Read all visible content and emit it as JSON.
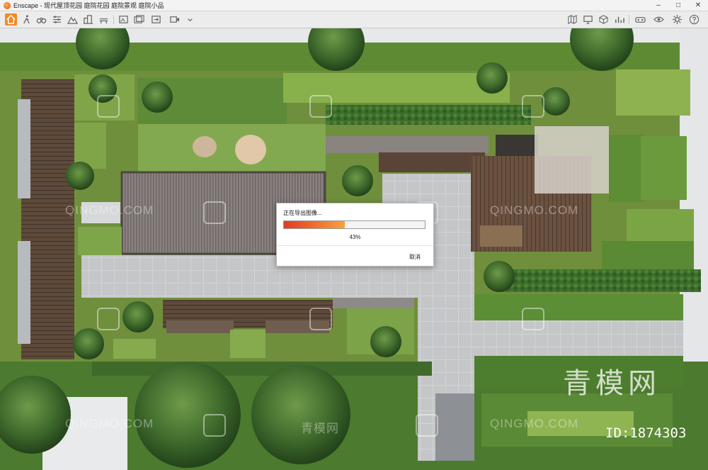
{
  "window": {
    "title": "Enscape - 现代屋顶花园 庭院花园 庭院景观 庭院小品",
    "controls": {
      "minimize": "–",
      "maximize": "□",
      "close": "✕"
    }
  },
  "toolbar": {
    "left_icons": [
      "home-icon",
      "walk-mode-icon",
      "binoculars-icon",
      "settings-sliders-icon",
      "mountain-icon",
      "person-icon",
      "buildings-icon",
      "bench-icon",
      "tree-icon",
      "screenshot-icon",
      "export-icon",
      "image-gallery-icon",
      "video-icon",
      "batch-render-icon",
      "panorama-icon"
    ],
    "right_icons": [
      "map-icon",
      "monitor-icon",
      "cube-icon",
      "chart-icon",
      "asset-library-icon",
      "vr-headset-icon",
      "visual-settings-icon",
      "eye-icon",
      "gear-icon",
      "help-icon"
    ],
    "active": "home-icon"
  },
  "dialog": {
    "title": "正在导出图像...",
    "progress": 0.43,
    "percent_text": "43%",
    "cancel_label": "取消",
    "bar_colors": {
      "start": "#e33a22",
      "end": "#f7a23c"
    }
  },
  "watermarks": {
    "text": "QINGMO.COM",
    "cn_text": "青模网",
    "big_text": "青模网",
    "id_text": "ID:1874303"
  }
}
